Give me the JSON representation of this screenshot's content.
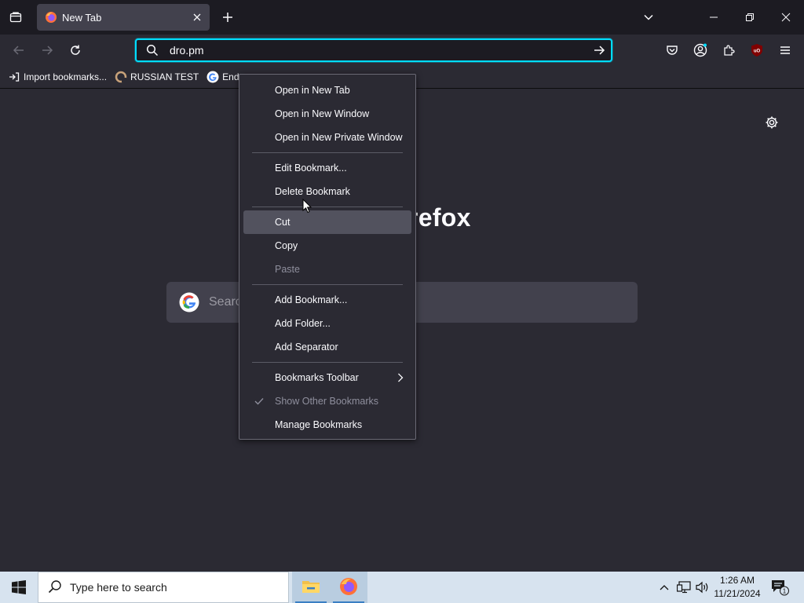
{
  "tab": {
    "title": "New Tab"
  },
  "urlbar": {
    "value": "dro.pm"
  },
  "bookmarks": [
    {
      "label": "Import bookmarks..."
    },
    {
      "label": "RUSSIAN TEST"
    },
    {
      "label": "Ende"
    }
  ],
  "content": {
    "brand_visible": "refox",
    "search_placeholder": "Search"
  },
  "context_menu": {
    "items": [
      {
        "label": "Open in New Tab",
        "type": "item"
      },
      {
        "label": "Open in New Window",
        "type": "item"
      },
      {
        "label": "Open in New Private Window",
        "type": "item"
      },
      {
        "type": "separator"
      },
      {
        "label": "Edit Bookmark...",
        "type": "item"
      },
      {
        "label": "Delete Bookmark",
        "type": "item"
      },
      {
        "type": "separator"
      },
      {
        "label": "Cut",
        "type": "item",
        "state": "hover"
      },
      {
        "label": "Copy",
        "type": "item"
      },
      {
        "label": "Paste",
        "type": "item",
        "state": "disabled"
      },
      {
        "type": "separator"
      },
      {
        "label": "Add Bookmark...",
        "type": "item"
      },
      {
        "label": "Add Folder...",
        "type": "item"
      },
      {
        "label": "Add Separator",
        "type": "item"
      },
      {
        "type": "separator"
      },
      {
        "label": "Bookmarks Toolbar",
        "type": "submenu"
      },
      {
        "label": "Show Other Bookmarks",
        "type": "item",
        "state": "disabled",
        "checked": true
      },
      {
        "label": "Manage Bookmarks",
        "type": "item"
      }
    ]
  },
  "taskbar": {
    "search_placeholder": "Type here to search",
    "time": "1:26 AM",
    "date": "11/21/2024",
    "notification_count": "1"
  },
  "colors": {
    "accent": "#00ddff",
    "toolbar_bg": "#2b2a33",
    "frame_bg": "#1c1b22",
    "menu_hover": "#52525e",
    "taskbar_bg": "#d7e3ef",
    "ublock_red": "#800000"
  },
  "icons": {
    "tab_list": "tab-list-icon",
    "firefox": "firefox-logo-icon",
    "close": "close-icon",
    "plus": "plus-icon",
    "chevron": "chevron-down-icon",
    "minimize": "minimize-icon",
    "restore": "restore-icon",
    "back": "back-arrow-icon",
    "forward": "forward-arrow-icon",
    "reload": "reload-icon",
    "search": "search-icon",
    "go": "go-arrow-icon",
    "pocket": "pocket-icon",
    "account": "account-icon",
    "extensions": "extensions-icon",
    "ublock": "ublock-origin-icon",
    "menu": "hamburger-menu-icon",
    "import": "import-icon",
    "gear": "gear-icon",
    "google": "google-icon",
    "windows": "windows-logo-icon",
    "file_explorer": "file-explorer-icon",
    "tray_chevron": "chevron-up-icon",
    "network": "network-icon",
    "volume": "volume-icon",
    "notifications": "notifications-icon",
    "check": "check-icon",
    "submenu_arrow": "chevron-right-icon"
  }
}
